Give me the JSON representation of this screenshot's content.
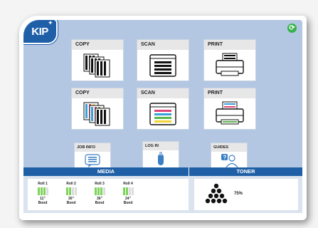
{
  "brand": {
    "logo": "KIP",
    "refresh_icon": "refresh-icon"
  },
  "tiles": {
    "copy_bw": {
      "label": "COPY",
      "icon": "copy-bw-icon"
    },
    "scan_bw": {
      "label": "SCAN",
      "icon": "scan-bw-icon"
    },
    "print_bw": {
      "label": "PRINT",
      "icon": "print-bw-icon"
    },
    "copy_color": {
      "label": "COPY",
      "icon": "copy-color-icon"
    },
    "scan_color": {
      "label": "SCAN",
      "icon": "scan-color-icon"
    },
    "print_color": {
      "label": "PRINT",
      "icon": "print-color-icon"
    }
  },
  "small_tiles": {
    "job_info": {
      "label": "JOB INFO",
      "icon": "job-info-icon"
    },
    "log_in": {
      "label": "LOG IN",
      "icon": "login-icon"
    },
    "guides": {
      "label": "GUIDES",
      "icon": "guides-icon"
    }
  },
  "media": {
    "title": "MEDIA",
    "rolls": [
      {
        "name": "Roll 1",
        "size": "11\"",
        "type": "Bond",
        "level": 0.75
      },
      {
        "name": "Roll 2",
        "size": "30\"",
        "type": "Bond",
        "level": 0.5
      },
      {
        "name": "Roll 3",
        "size": "36\"",
        "type": "Bond",
        "level": 0.75
      },
      {
        "name": "Roll 4",
        "size": "24\"",
        "type": "Bond",
        "level": 0.5
      }
    ]
  },
  "toner": {
    "title": "TONER",
    "percent": "75%"
  },
  "colors": {
    "accent": "#1e5fa6",
    "screen": "#b3c7e2",
    "gauge_full": "#7ed35a",
    "gauge_empty": "#dcdcdc"
  }
}
